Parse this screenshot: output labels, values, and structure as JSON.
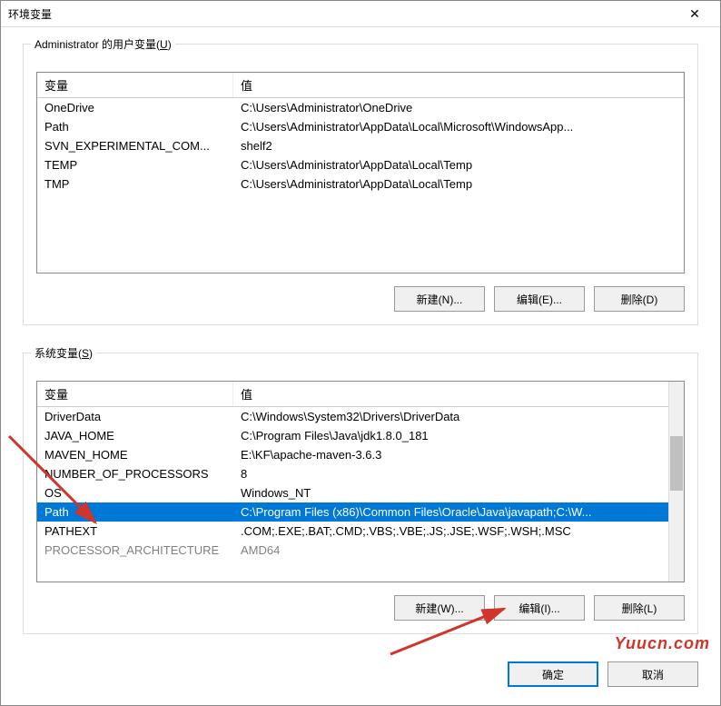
{
  "window": {
    "title": "环境变量"
  },
  "user_vars": {
    "legend_prefix": "Administrator 的用户变量(",
    "legend_key": "U",
    "legend_suffix": ")",
    "header_name": "变量",
    "header_value": "值",
    "rows": [
      {
        "name": "OneDrive",
        "value": "C:\\Users\\Administrator\\OneDrive"
      },
      {
        "name": "Path",
        "value": "C:\\Users\\Administrator\\AppData\\Local\\Microsoft\\WindowsApp..."
      },
      {
        "name": "SVN_EXPERIMENTAL_COM...",
        "value": "shelf2"
      },
      {
        "name": "TEMP",
        "value": "C:\\Users\\Administrator\\AppData\\Local\\Temp"
      },
      {
        "name": "TMP",
        "value": "C:\\Users\\Administrator\\AppData\\Local\\Temp"
      }
    ],
    "buttons": {
      "new": "新建(N)...",
      "edit": "编辑(E)...",
      "delete": "删除(D)"
    }
  },
  "system_vars": {
    "legend_prefix": "系统变量(",
    "legend_key": "S",
    "legend_suffix": ")",
    "header_name": "变量",
    "header_value": "值",
    "rows": [
      {
        "name": "DriverData",
        "value": "C:\\Windows\\System32\\Drivers\\DriverData"
      },
      {
        "name": "JAVA_HOME",
        "value": "C:\\Program Files\\Java\\jdk1.8.0_181"
      },
      {
        "name": "MAVEN_HOME",
        "value": "E:\\KF\\apache-maven-3.6.3"
      },
      {
        "name": "NUMBER_OF_PROCESSORS",
        "value": "8"
      },
      {
        "name": "OS",
        "value": "Windows_NT"
      },
      {
        "name": "Path",
        "value": "C:\\Program Files (x86)\\Common Files\\Oracle\\Java\\javapath;C:\\W...",
        "selected": true
      },
      {
        "name": "PATHEXT",
        "value": ".COM;.EXE;.BAT;.CMD;.VBS;.VBE;.JS;.JSE;.WSF;.WSH;.MSC"
      },
      {
        "name": "PROCESSOR_ARCHITECTURE",
        "value": "AMD64",
        "partial": true
      }
    ],
    "buttons": {
      "new": "新建(W)...",
      "edit": "编辑(I)...",
      "delete": "删除(L)"
    }
  },
  "footer": {
    "ok": "确定",
    "cancel": "取消"
  },
  "watermark": "Yuucn.com"
}
